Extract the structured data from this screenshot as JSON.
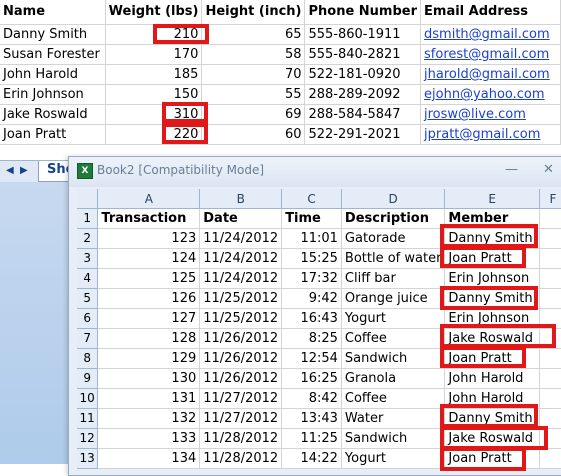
{
  "sheet1": {
    "headers": [
      "Name",
      "Weight (lbs)",
      "Height (inch)",
      "Phone Number",
      "Email Address"
    ],
    "rows": [
      {
        "name": "Danny Smith",
        "weight": "210",
        "height": "65",
        "phone": "555-860-1911",
        "email": "dsmith@gmail.com"
      },
      {
        "name": "Susan Forester",
        "weight": "170",
        "height": "58",
        "phone": "555-840-2821",
        "email": "sforest@gmail.com"
      },
      {
        "name": "John Harold",
        "weight": "185",
        "height": "70",
        "phone": "522-181-0920",
        "email": "jharold@gmail.com"
      },
      {
        "name": "Erin Johnson",
        "weight": "150",
        "height": "55",
        "phone": "288-289-2092",
        "email": "ejohn@yahoo.com"
      },
      {
        "name": "Jake Roswald",
        "weight": "310",
        "height": "69",
        "phone": "288-584-5847",
        "email": "jrosw@live.com"
      },
      {
        "name": "Joan Pratt",
        "weight": "220",
        "height": "60",
        "phone": "522-291-2021",
        "email": "jpratt@gmail.com"
      }
    ],
    "tab_label": "She"
  },
  "book2": {
    "title": "Book2  [Compatibility Mode]",
    "columns": [
      "A",
      "B",
      "C",
      "D",
      "E",
      "F"
    ],
    "row_numbers": [
      "1",
      "2",
      "3",
      "4",
      "5",
      "6",
      "7",
      "8",
      "9",
      "10",
      "11",
      "12",
      "13"
    ],
    "headers": [
      "Transaction",
      "Date",
      "Time",
      "Description",
      "Member"
    ],
    "rows": [
      {
        "transaction": "123",
        "date": "11/24/2012",
        "time": "11:01",
        "description": "Gatorade",
        "member": "Danny Smith"
      },
      {
        "transaction": "124",
        "date": "11/24/2012",
        "time": "15:25",
        "description": "Bottle of water",
        "member": "Joan Pratt"
      },
      {
        "transaction": "125",
        "date": "11/24/2012",
        "time": "17:32",
        "description": "Cliff bar",
        "member": "Erin Johnson"
      },
      {
        "transaction": "126",
        "date": "11/25/2012",
        "time": "9:42",
        "description": "Orange juice",
        "member": "Danny Smith"
      },
      {
        "transaction": "127",
        "date": "11/25/2012",
        "time": "16:43",
        "description": "Yogurt",
        "member": "Erin Johnson"
      },
      {
        "transaction": "128",
        "date": "11/26/2012",
        "time": "8:25",
        "description": "Coffee",
        "member": "Jake Roswald"
      },
      {
        "transaction": "129",
        "date": "11/26/2012",
        "time": "12:54",
        "description": "Sandwich",
        "member": "Joan Pratt"
      },
      {
        "transaction": "130",
        "date": "11/26/2012",
        "time": "16:25",
        "description": "Granola",
        "member": "John Harold"
      },
      {
        "transaction": "131",
        "date": "11/27/2012",
        "time": "8:42",
        "description": "Coffee",
        "member": "John Harold"
      },
      {
        "transaction": "132",
        "date": "11/27/2012",
        "time": "13:43",
        "description": "Water",
        "member": "Danny Smith"
      },
      {
        "transaction": "133",
        "date": "11/28/2012",
        "time": "11:25",
        "description": "Sandwich",
        "member": "Jake Roswald"
      },
      {
        "transaction": "134",
        "date": "11/28/2012",
        "time": "14:22",
        "description": "Yogurt",
        "member": "Joan Pratt"
      }
    ]
  },
  "colors": {
    "highlight_border": "#e0181a",
    "link": "#1a3fd6",
    "header_bg": "#e4ecf7"
  },
  "icons": {
    "excel": "excel-icon",
    "minimize": "minimize-icon",
    "close": "close-icon"
  }
}
